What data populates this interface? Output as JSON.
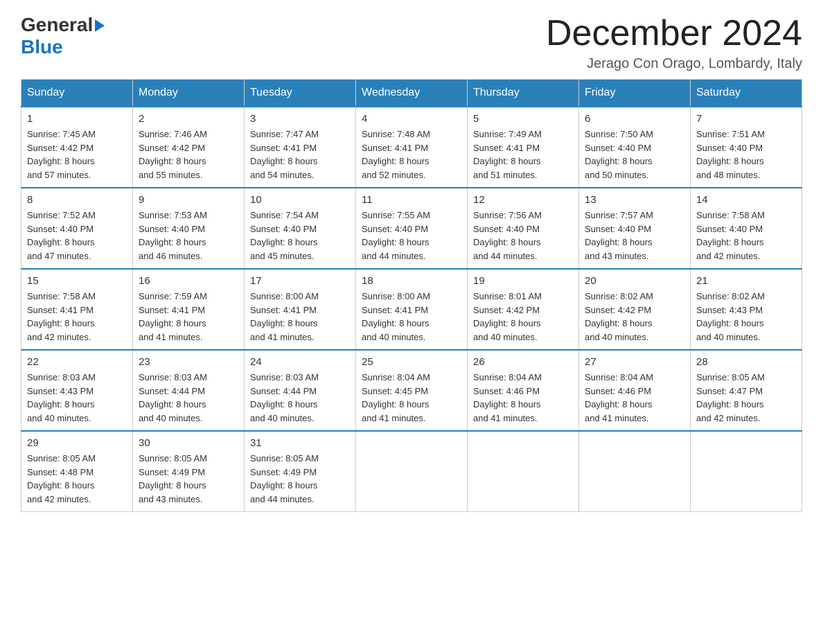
{
  "logo": {
    "text_general": "General",
    "text_blue": "Blue",
    "arrow": "▶"
  },
  "header": {
    "month_year": "December 2024",
    "location": "Jerago Con Orago, Lombardy, Italy"
  },
  "weekdays": [
    "Sunday",
    "Monday",
    "Tuesday",
    "Wednesday",
    "Thursday",
    "Friday",
    "Saturday"
  ],
  "weeks": [
    [
      {
        "day": "1",
        "sunrise": "7:45 AM",
        "sunset": "4:42 PM",
        "daylight": "8 hours and 57 minutes."
      },
      {
        "day": "2",
        "sunrise": "7:46 AM",
        "sunset": "4:42 PM",
        "daylight": "8 hours and 55 minutes."
      },
      {
        "day": "3",
        "sunrise": "7:47 AM",
        "sunset": "4:41 PM",
        "daylight": "8 hours and 54 minutes."
      },
      {
        "day": "4",
        "sunrise": "7:48 AM",
        "sunset": "4:41 PM",
        "daylight": "8 hours and 52 minutes."
      },
      {
        "day": "5",
        "sunrise": "7:49 AM",
        "sunset": "4:41 PM",
        "daylight": "8 hours and 51 minutes."
      },
      {
        "day": "6",
        "sunrise": "7:50 AM",
        "sunset": "4:40 PM",
        "daylight": "8 hours and 50 minutes."
      },
      {
        "day": "7",
        "sunrise": "7:51 AM",
        "sunset": "4:40 PM",
        "daylight": "8 hours and 48 minutes."
      }
    ],
    [
      {
        "day": "8",
        "sunrise": "7:52 AM",
        "sunset": "4:40 PM",
        "daylight": "8 hours and 47 minutes."
      },
      {
        "day": "9",
        "sunrise": "7:53 AM",
        "sunset": "4:40 PM",
        "daylight": "8 hours and 46 minutes."
      },
      {
        "day": "10",
        "sunrise": "7:54 AM",
        "sunset": "4:40 PM",
        "daylight": "8 hours and 45 minutes."
      },
      {
        "day": "11",
        "sunrise": "7:55 AM",
        "sunset": "4:40 PM",
        "daylight": "8 hours and 44 minutes."
      },
      {
        "day": "12",
        "sunrise": "7:56 AM",
        "sunset": "4:40 PM",
        "daylight": "8 hours and 44 minutes."
      },
      {
        "day": "13",
        "sunrise": "7:57 AM",
        "sunset": "4:40 PM",
        "daylight": "8 hours and 43 minutes."
      },
      {
        "day": "14",
        "sunrise": "7:58 AM",
        "sunset": "4:40 PM",
        "daylight": "8 hours and 42 minutes."
      }
    ],
    [
      {
        "day": "15",
        "sunrise": "7:58 AM",
        "sunset": "4:41 PM",
        "daylight": "8 hours and 42 minutes."
      },
      {
        "day": "16",
        "sunrise": "7:59 AM",
        "sunset": "4:41 PM",
        "daylight": "8 hours and 41 minutes."
      },
      {
        "day": "17",
        "sunrise": "8:00 AM",
        "sunset": "4:41 PM",
        "daylight": "8 hours and 41 minutes."
      },
      {
        "day": "18",
        "sunrise": "8:00 AM",
        "sunset": "4:41 PM",
        "daylight": "8 hours and 40 minutes."
      },
      {
        "day": "19",
        "sunrise": "8:01 AM",
        "sunset": "4:42 PM",
        "daylight": "8 hours and 40 minutes."
      },
      {
        "day": "20",
        "sunrise": "8:02 AM",
        "sunset": "4:42 PM",
        "daylight": "8 hours and 40 minutes."
      },
      {
        "day": "21",
        "sunrise": "8:02 AM",
        "sunset": "4:43 PM",
        "daylight": "8 hours and 40 minutes."
      }
    ],
    [
      {
        "day": "22",
        "sunrise": "8:03 AM",
        "sunset": "4:43 PM",
        "daylight": "8 hours and 40 minutes."
      },
      {
        "day": "23",
        "sunrise": "8:03 AM",
        "sunset": "4:44 PM",
        "daylight": "8 hours and 40 minutes."
      },
      {
        "day": "24",
        "sunrise": "8:03 AM",
        "sunset": "4:44 PM",
        "daylight": "8 hours and 40 minutes."
      },
      {
        "day": "25",
        "sunrise": "8:04 AM",
        "sunset": "4:45 PM",
        "daylight": "8 hours and 41 minutes."
      },
      {
        "day": "26",
        "sunrise": "8:04 AM",
        "sunset": "4:46 PM",
        "daylight": "8 hours and 41 minutes."
      },
      {
        "day": "27",
        "sunrise": "8:04 AM",
        "sunset": "4:46 PM",
        "daylight": "8 hours and 41 minutes."
      },
      {
        "day": "28",
        "sunrise": "8:05 AM",
        "sunset": "4:47 PM",
        "daylight": "8 hours and 42 minutes."
      }
    ],
    [
      {
        "day": "29",
        "sunrise": "8:05 AM",
        "sunset": "4:48 PM",
        "daylight": "8 hours and 42 minutes."
      },
      {
        "day": "30",
        "sunrise": "8:05 AM",
        "sunset": "4:49 PM",
        "daylight": "8 hours and 43 minutes."
      },
      {
        "day": "31",
        "sunrise": "8:05 AM",
        "sunset": "4:49 PM",
        "daylight": "8 hours and 44 minutes."
      },
      null,
      null,
      null,
      null
    ]
  ],
  "labels": {
    "sunrise": "Sunrise:",
    "sunset": "Sunset:",
    "daylight": "Daylight:"
  }
}
